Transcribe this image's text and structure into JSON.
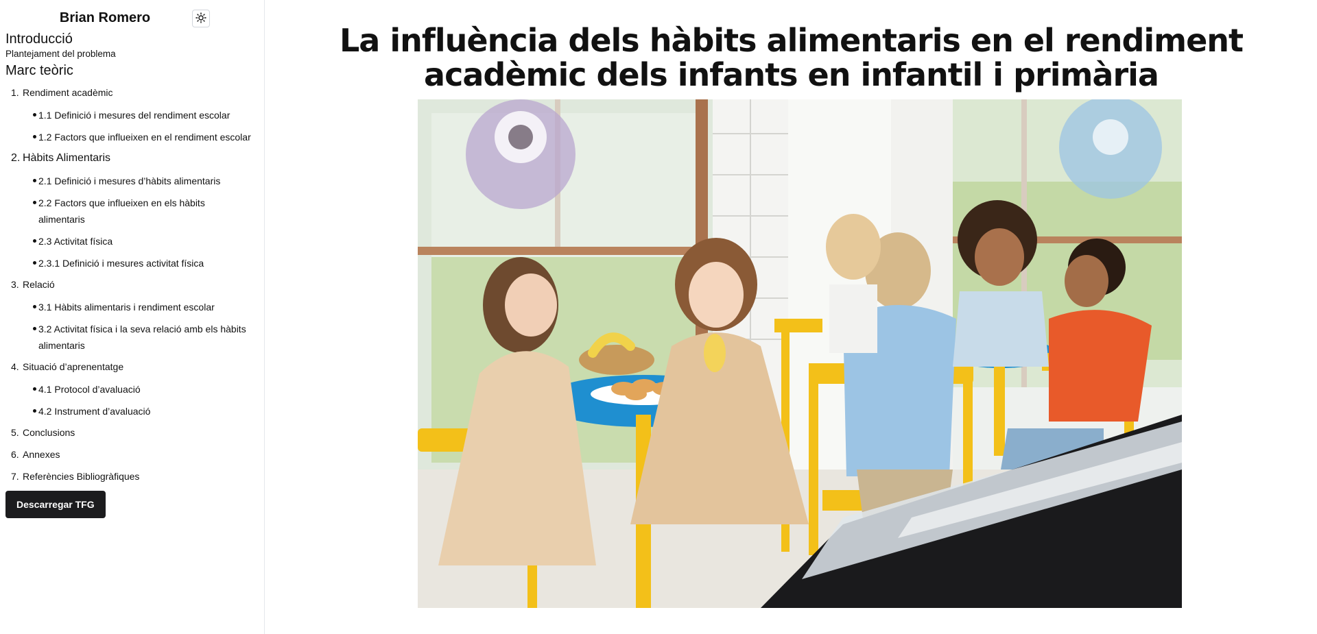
{
  "sidebar": {
    "author": "Brian Romero",
    "intro_title": "Introducció",
    "intro_sub": "Plantejament del problema",
    "marc_title": "Marc teòric",
    "toc": [
      {
        "num": "1.",
        "label": "Rendiment acadèmic",
        "subs": [
          "1.1 Definició i mesures del rendiment escolar",
          "1.2 Factors que influeixen en el rendiment escolar"
        ]
      },
      {
        "num": "2.",
        "label": "Hàbits Alimentaris",
        "subs": [
          "2.1 Definició i mesures d’hàbits alimentaris",
          "2.2 Factors que influeixen en els hàbits alimentaris",
          "2.3 Activitat física",
          "2.3.1 Definició i mesures activitat física"
        ]
      },
      {
        "num": "3.",
        "label": "Relació",
        "subs": [
          "3.1 Hàbits alimentaris i rendiment escolar",
          "3.2 Activitat física i la seva relació amb els hàbits alimentaris"
        ]
      },
      {
        "num": "4.",
        "label": "Situació d’aprenentatge",
        "subs": [
          "4.1 Protocol d’avaluació",
          "4.2 Instrument d’avaluació"
        ]
      },
      {
        "num": "5.",
        "label": "Conclusions",
        "subs": []
      },
      {
        "num": "6.",
        "label": "Annexes",
        "subs": []
      },
      {
        "num": "7.",
        "label": "Referències Bibliogràfiques",
        "subs": []
      }
    ],
    "download_label": "Descarregar TFG",
    "theme_icon": "sun-icon"
  },
  "main": {
    "title": "La influència dels hàbits alimentaris en el rendiment acadèmic dels infants en infantil i primària",
    "hero_image": "children-eating-at-cafeteria-table-photo"
  },
  "colors": {
    "button_bg": "#1c1c1e",
    "chair_yellow": "#f3c019",
    "table_blue": "#1f8fd0"
  }
}
